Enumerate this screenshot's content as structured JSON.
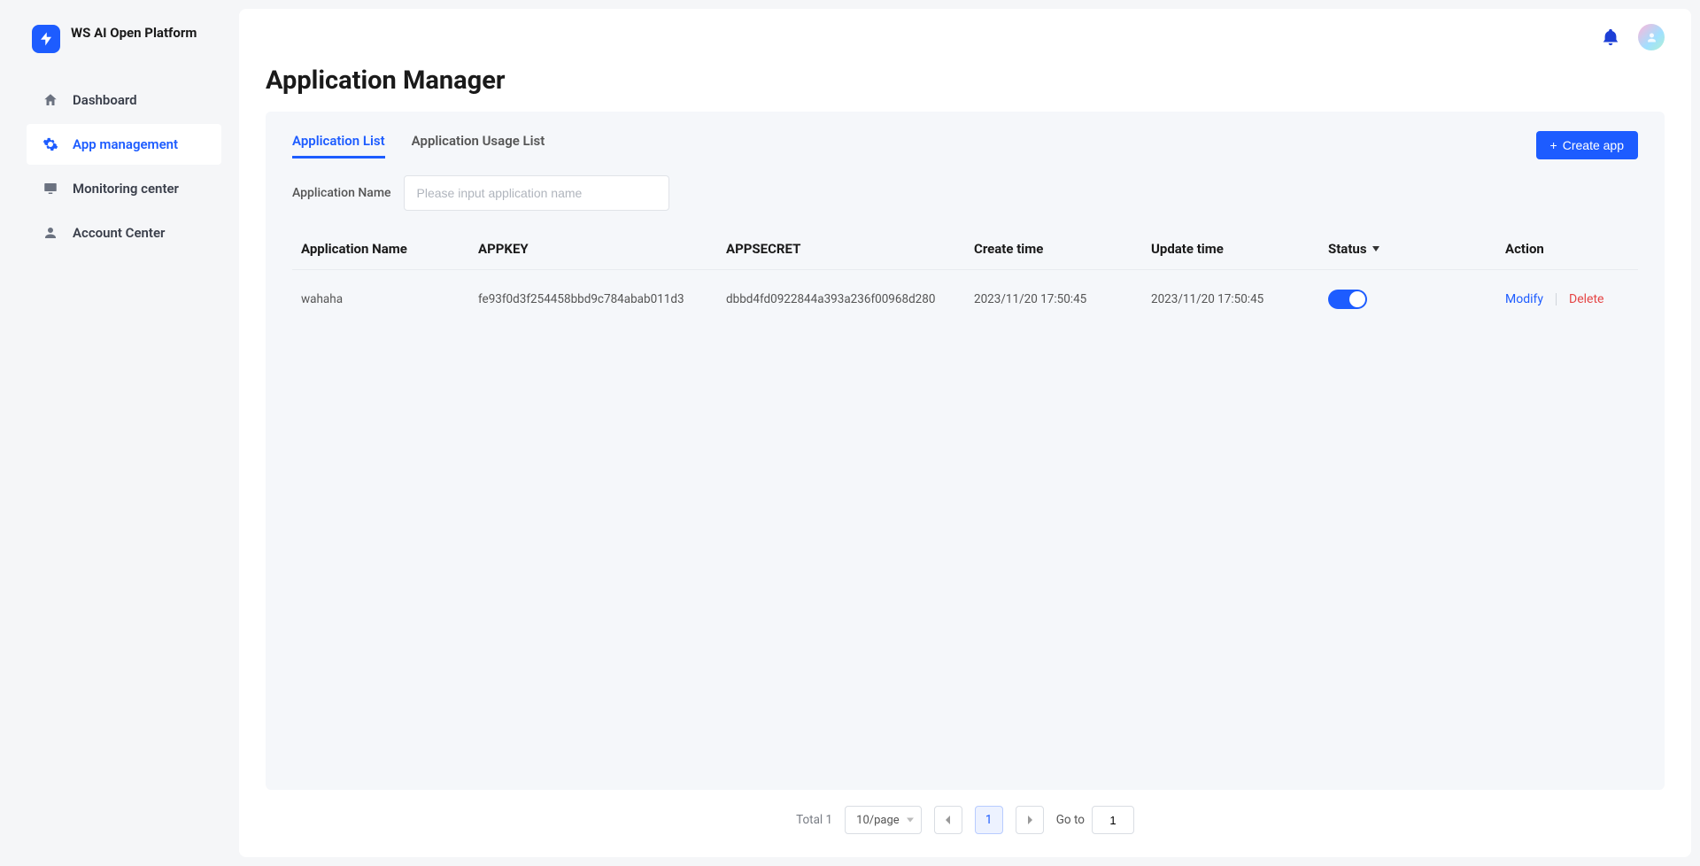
{
  "brand": {
    "name": "WS AI Open Platform"
  },
  "sidebar": {
    "items": [
      {
        "label": "Dashboard"
      },
      {
        "label": "App management"
      },
      {
        "label": "Monitoring center"
      },
      {
        "label": "Account Center"
      }
    ]
  },
  "page": {
    "title": "Application Manager"
  },
  "tabs": [
    {
      "label": "Application List"
    },
    {
      "label": "Application Usage List"
    }
  ],
  "actions": {
    "create_label": "Create app"
  },
  "filter": {
    "label": "Application Name",
    "placeholder": "Please input application name"
  },
  "table": {
    "headers": {
      "name": "Application Name",
      "key": "APPKEY",
      "secret": "APPSECRET",
      "create": "Create time",
      "update": "Update time",
      "status": "Status",
      "action": "Action"
    },
    "rows": [
      {
        "name": "wahaha",
        "key": "fe93f0d3f254458bbd9c784abab011d3",
        "secret": "dbbd4fd0922844a393a236f00968d280",
        "create": "2023/11/20 17:50:45",
        "update": "2023/11/20 17:50:45",
        "status": true
      }
    ],
    "action_labels": {
      "modify": "Modify",
      "delete": "Delete"
    }
  },
  "pagination": {
    "total_label": "Total 1",
    "page_size_label": "10/page",
    "current": "1",
    "goto_label": "Go to",
    "goto_value": "1"
  }
}
